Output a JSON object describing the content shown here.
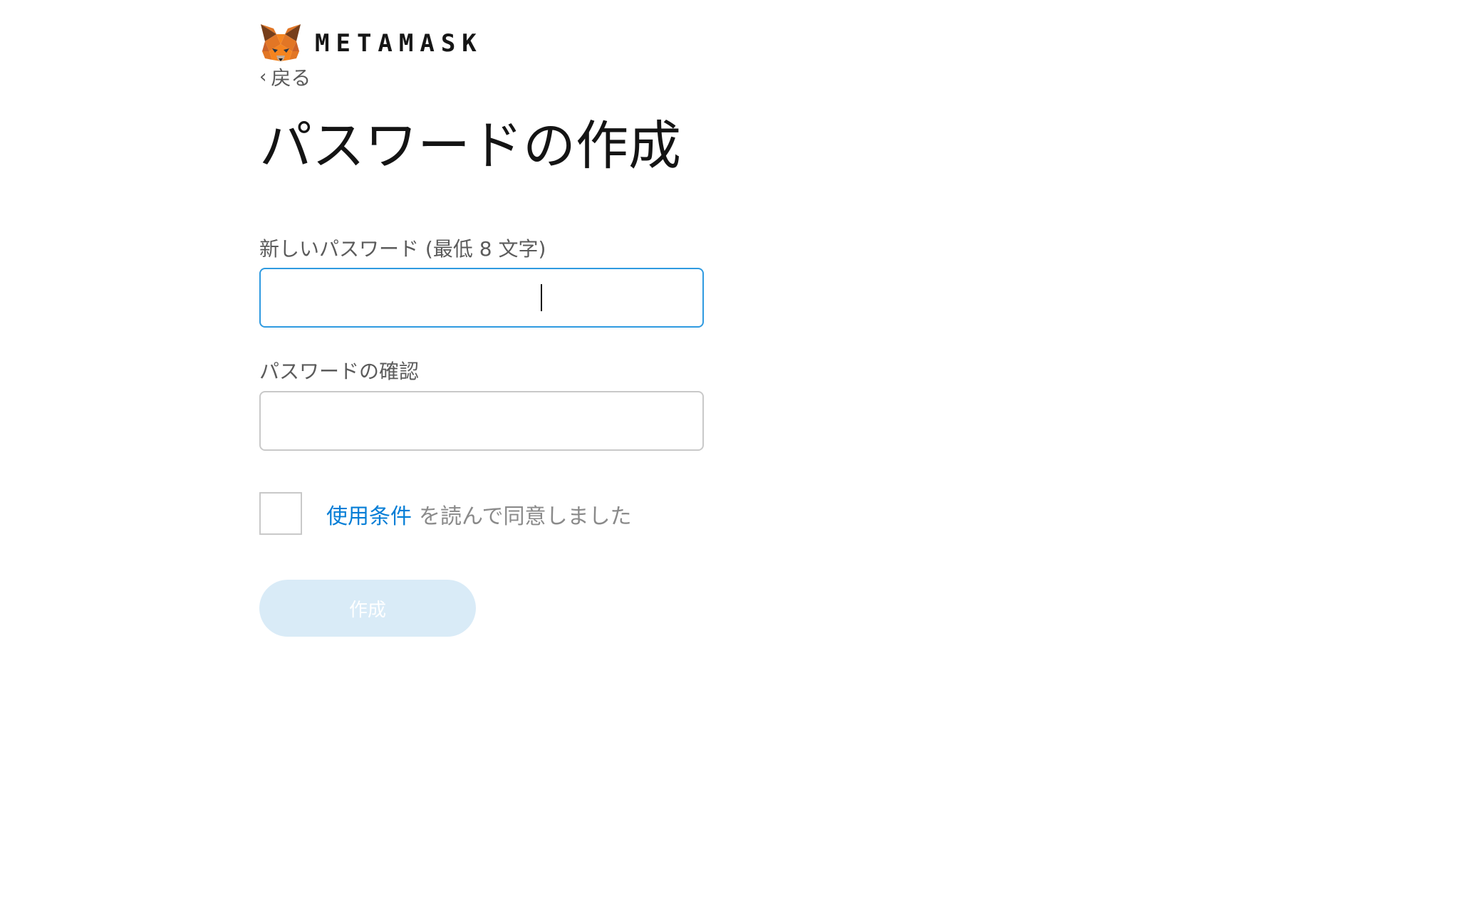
{
  "brand": {
    "wordmark": "METAMASK",
    "logo_icon": "metamask-fox-icon",
    "colors": {
      "fox_orange": "#e2761b",
      "fox_dark": "#763d16"
    }
  },
  "nav": {
    "back_label": "戻る",
    "back_icon": "chevron-left-icon"
  },
  "page": {
    "title": "パスワードの作成"
  },
  "form": {
    "new_password": {
      "label": "新しいパスワード (最低 8 文字)",
      "value": "",
      "focused": true
    },
    "confirm_password": {
      "label": "パスワードの確認",
      "value": ""
    },
    "terms": {
      "checked": false,
      "link_text": "使用条件",
      "rest_text": "を読んで同意しました"
    },
    "submit": {
      "label": "作成",
      "disabled": true
    }
  },
  "colors": {
    "accent": "#037dd6",
    "focus_border": "#2f9ae0",
    "input_border": "#c9c9c9",
    "button_disabled_bg": "#d9ebf7"
  }
}
